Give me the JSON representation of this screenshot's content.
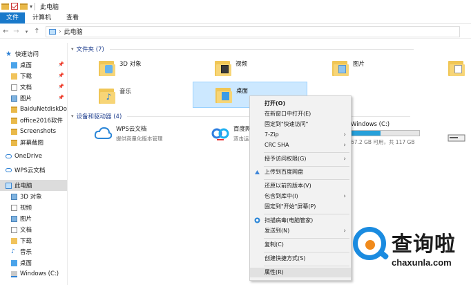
{
  "window": {
    "title": "此电脑"
  },
  "ribbon": {
    "tabs": [
      "文件",
      "计算机",
      "查看"
    ]
  },
  "address": {
    "path": "此电脑",
    "separator": "›"
  },
  "sidebar": {
    "items": [
      {
        "label": "快速访问",
        "icon": "star-icon"
      },
      {
        "label": "桌面",
        "icon": "desktop-folder-icon",
        "pinned": true
      },
      {
        "label": "下载",
        "icon": "download-folder-icon",
        "pinned": true
      },
      {
        "label": "文档",
        "icon": "documents-folder-icon",
        "pinned": true
      },
      {
        "label": "图片",
        "icon": "pictures-folder-icon",
        "pinned": true
      },
      {
        "label": "BaiduNetdiskDow",
        "icon": "folder-icon"
      },
      {
        "label": "office2016软件",
        "icon": "folder-icon"
      },
      {
        "label": "Screenshots",
        "icon": "folder-icon"
      },
      {
        "label": "屏幕截图",
        "icon": "folder-icon"
      },
      {
        "label": "OneDrive",
        "icon": "onedrive-icon"
      },
      {
        "label": "WPS云文档",
        "icon": "wps-cloud-icon"
      },
      {
        "label": "此电脑",
        "icon": "this-pc-icon",
        "selected": true
      },
      {
        "label": "3D 对象",
        "icon": "3d-objects-icon"
      },
      {
        "label": "视频",
        "icon": "videos-folder-icon"
      },
      {
        "label": "图片",
        "icon": "pictures-folder-icon"
      },
      {
        "label": "文档",
        "icon": "documents-folder-icon"
      },
      {
        "label": "下载",
        "icon": "download-folder-icon"
      },
      {
        "label": "音乐",
        "icon": "music-folder-icon"
      },
      {
        "label": "桌面",
        "icon": "desktop-folder-icon"
      },
      {
        "label": "Windows (C:)",
        "icon": "windows-drive-icon"
      }
    ],
    "pin_glyph": "📌"
  },
  "main": {
    "folders_header": "文件夹 (7)",
    "folders": [
      {
        "label": "3D 对象",
        "icon": "3d-objects-folder-icon"
      },
      {
        "label": "视频",
        "icon": "videos-folder-icon"
      },
      {
        "label": "图片",
        "icon": "pictures-folder-icon"
      },
      {
        "label": "",
        "icon": "documents-folder-icon"
      },
      {
        "label": "音乐",
        "icon": "music-folder-icon"
      },
      {
        "label": "桌面",
        "icon": "desktop-folder-icon",
        "selected": true
      }
    ],
    "devices_header": "设备和驱动器 (4)",
    "devices": [
      {
        "name": "WPS云文档",
        "sub": "提供商量化版本管理",
        "icon": "wps-cloud-drive-icon"
      },
      {
        "name": "百度网",
        "sub": "双击运",
        "icon": "baidu-netdisk-icon"
      },
      {
        "name": "Windows (C:)",
        "sub": "67.2 GB 可用，共 117 GB",
        "icon": "windows-drive-icon",
        "usage": 0.43
      },
      {
        "name": "",
        "sub": "",
        "icon": "dvd-drive-icon"
      }
    ]
  },
  "context_menu": {
    "items": [
      {
        "label": "打开(O)",
        "bold": true
      },
      {
        "label": "在新窗口中打开(E)"
      },
      {
        "label": "固定到\"快速访问\""
      },
      {
        "label": "7-Zip",
        "submenu": true
      },
      {
        "label": "CRC SHA",
        "submenu": true
      },
      {
        "sep": true
      },
      {
        "label": "授予访问权限(G)",
        "submenu": true
      },
      {
        "sep": true
      },
      {
        "label": "上传到百度网盘",
        "icon": "baidu-upload-icon"
      },
      {
        "sep": true
      },
      {
        "label": "还原以前的版本(V)"
      },
      {
        "label": "包含到库中(I)",
        "submenu": true
      },
      {
        "label": "固定到\"开始\"屏幕(P)"
      },
      {
        "sep": true
      },
      {
        "label": "扫描病毒(电脑管家)",
        "icon": "pc-manager-icon"
      },
      {
        "label": "发送到(N)",
        "submenu": true
      },
      {
        "sep": true
      },
      {
        "label": "复制(C)"
      },
      {
        "sep": true
      },
      {
        "label": "创建快捷方式(S)"
      },
      {
        "sep": true
      },
      {
        "label": "属性(R)",
        "hover": true
      }
    ],
    "submenu_glyph": "›"
  },
  "watermark": {
    "title": "查询啦",
    "url": "chaxunla.com"
  },
  "colors": {
    "accent": "#1979ca",
    "selection": "#cce8ff",
    "folder": "#f0c656",
    "drive_fill": "#26a0da"
  }
}
